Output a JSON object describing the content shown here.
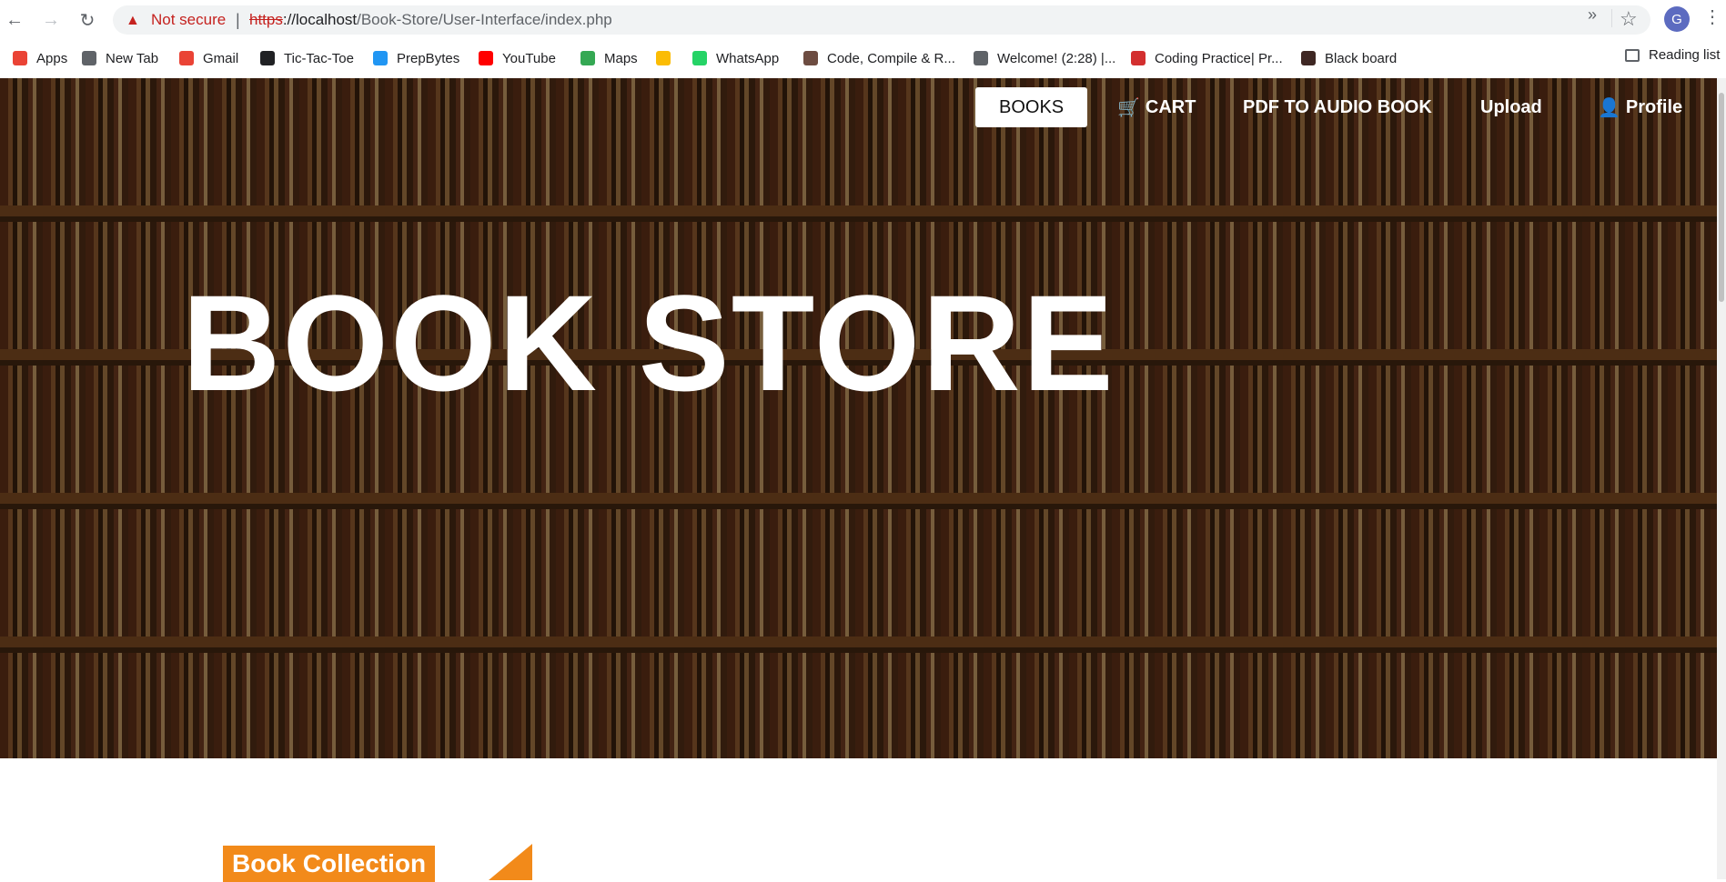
{
  "browser": {
    "not_secure": "Not secure",
    "url_scheme": "https",
    "url_rest_host": "://localhost",
    "url_path": "/Book-Store/User-Interface/index.php",
    "avatar_letter": "G",
    "reading_list": "Reading list"
  },
  "bookmarks": [
    {
      "label": "Apps",
      "icon": "apps-grid-icon",
      "color": "#ea4335"
    },
    {
      "label": "New Tab",
      "icon": "globe-icon",
      "color": "#5f6368"
    },
    {
      "label": "Gmail",
      "icon": "gmail-icon",
      "color": "#ea4335"
    },
    {
      "label": "Tic-Tac-Toe",
      "icon": "github-icon",
      "color": "#202124"
    },
    {
      "label": "PrepBytes",
      "icon": "prepbytes-icon",
      "color": "#2196f3"
    },
    {
      "label": "YouTube",
      "icon": "youtube-icon",
      "color": "#ff0000"
    },
    {
      "label": "Maps",
      "icon": "maps-icon",
      "color": "#34a853"
    },
    {
      "label": "",
      "icon": "drive-icon",
      "color": "#fbbc04"
    },
    {
      "label": "WhatsApp",
      "icon": "whatsapp-icon",
      "color": "#25d366"
    },
    {
      "label": "Code, Compile & R...",
      "icon": "cc-icon",
      "color": "#6d4c41"
    },
    {
      "label": "Welcome! (2:28) |...",
      "icon": "globe-icon",
      "color": "#5f6368"
    },
    {
      "label": "Coding Practice| Pr...",
      "icon": "tg-icon",
      "color": "#d32f2f"
    },
    {
      "label": "Black board",
      "icon": "blackboard-icon",
      "color": "#3e2723"
    }
  ],
  "site_nav": {
    "books": "BOOKS",
    "cart": "CART",
    "pdf_to_audio": "PDF TO AUDIO BOOK",
    "upload": "Upload",
    "profile": "Profile"
  },
  "hero": {
    "title": "BOOK STORE"
  },
  "section": {
    "book_collection": "Book Collection"
  }
}
